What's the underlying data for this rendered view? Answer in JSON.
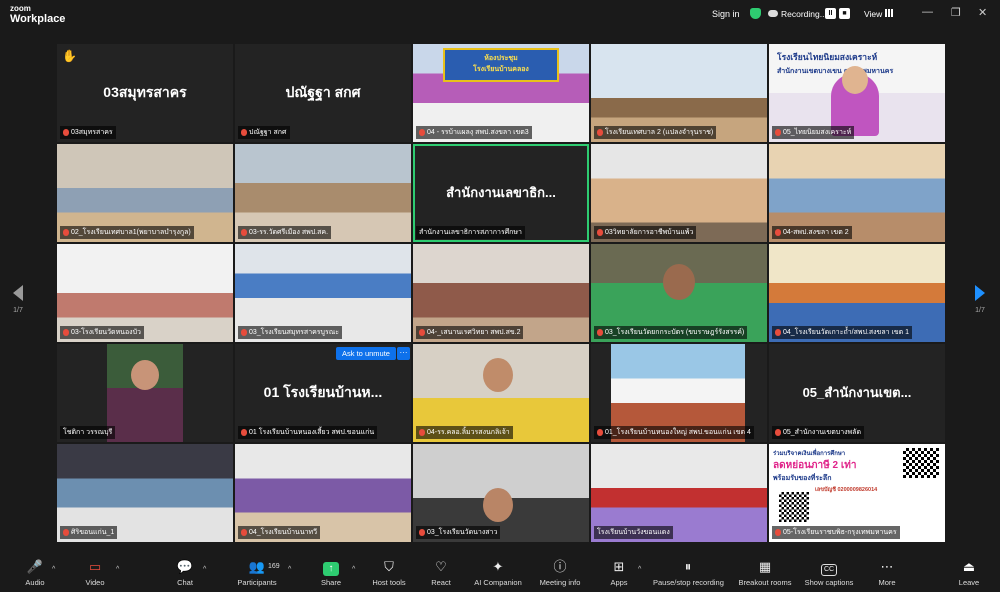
{
  "app": {
    "logo_line1": "zoom",
    "logo_line2": "Workplace"
  },
  "topbar": {
    "signin": "Sign in",
    "recording": "Recording...",
    "view": "View",
    "pause_glyph": "II",
    "stop_glyph": "■",
    "minimize": "—",
    "restore": "❐",
    "close": "✕"
  },
  "unmute": {
    "label": "Ask to unmute",
    "more": "···"
  },
  "pagination": {
    "left": "1/7",
    "right": "1/7"
  },
  "tiles": [
    {
      "label": "03สมุทรสาคร",
      "big": "03สมุทรสาคร",
      "hand": "✋"
    },
    {
      "label": "ปณัฐฐา สกศ",
      "big": "ปณัฐฐา สกศ"
    },
    {
      "label": "04 - รรบ้าแผลงุ สพป.สงขลา เขต3"
    },
    {
      "label": "โรงเรียนเทศบาล 2 (แปลงจำรุนราช)"
    },
    {
      "label": "05_ไทยนิยมสงเคราะห์"
    },
    {
      "label": "02_โรงเรียนเทศบาล1(พยาบาลบำรุงกูล)"
    },
    {
      "label": "03-รร.วัดศรีเมือง สพป.สค."
    },
    {
      "label": "สำนักงานเลขาธิการสภาการศึกษา",
      "big": "สำนักงานเลขาธิก..."
    },
    {
      "label": "03วิทยาลัยการอาชีพบ้านแพ้ว"
    },
    {
      "label": "04-สพป.สงขลา เขต 2"
    },
    {
      "label": "03-โรงเรียนวัดหนองบัว"
    },
    {
      "label": "03_โรงเรียนสมุทรสาครบูรณะ"
    },
    {
      "label": "04-_เสนานเรศวิทยา สพป.สข.2"
    },
    {
      "label": "03_โรงเรียนวัดยกกระบัตร (ขบราษฎร์รังสรรค์)"
    },
    {
      "label": "04_โรงเรียนวัดเกาะถ้ำ/สพป.สงขลา เขต 1"
    },
    {
      "label": "โชติกา วรรณบุรี"
    },
    {
      "label": "01 โรงเรียนบ้านหนองเสี้ยว สพป.ขอนแก่น",
      "big": "01 โรงเรียนบ้านห..."
    },
    {
      "label": "04-รร.คลอ.ลิ้มวรสงนกลิเจ้า"
    },
    {
      "label": "01_โรงเรียนบ้านหนองใหญ่ สพป.ขอนแก่น เขต 4"
    },
    {
      "label": "05_สำนักงานเขตบางพลัด",
      "big": "05_สำนักงานเขต..."
    },
    {
      "label": "ศิริขอนแก่น_1"
    },
    {
      "label": "04_โรงเรียนบ้านนาทวี"
    },
    {
      "label": "03_โรงเรียนวัดนางสาว"
    },
    {
      "label": "โรงเรียนบ้านวังขอนแดง"
    },
    {
      "label": "05-โรงเรียนราชบพิธ-กรุงเทพมหานคร"
    }
  ],
  "slides": {
    "t3_sign": "ห้องประชุม",
    "t3_sign2": "โรงเรียนบ้านคลอง",
    "t5_banner": "โรงเรียนไทยนิยมสงเคราะห์",
    "t5_banner2": "สำนักงานเขตบางเขน กรุงเทพมหานคร",
    "t25_head": "ร่วมบริจาคเงินเพื่อการศึกษา",
    "t25_main": "ลดหย่อนภาษี 2 เท่า",
    "t25_sub": "พร้อมรับของที่ระลึก",
    "t25_account": "เลขบัญชี 0200009826014"
  },
  "toolbar": {
    "audio": "Audio",
    "video": "Video",
    "chat": "Chat",
    "participants": "Participants",
    "participants_count": "169",
    "share": "Share",
    "host_tools": "Host tools",
    "react": "React",
    "ai_companion": "AI Companion",
    "meeting_info": "Meeting info",
    "apps": "Apps",
    "pause_recording": "Pause/stop recording",
    "breakout": "Breakout rooms",
    "captions": "Show captions",
    "more": "More",
    "leave": "Leave",
    "cc": "CC",
    "caret": "^"
  },
  "colors": {
    "accent_blue": "#0e71eb",
    "active_green": "#2ecc71",
    "mic_off_red": "#e74c3c"
  }
}
